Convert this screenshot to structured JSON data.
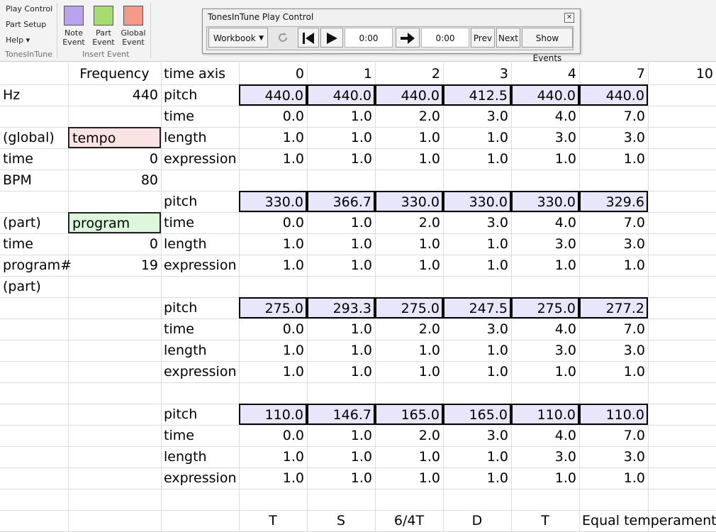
{
  "ribbon": {
    "links": [
      "Play Control",
      "Part Setup",
      "Help ▾"
    ],
    "group1_label": "TonesInTune",
    "events": [
      {
        "label1": "Note",
        "label2": "Event",
        "color": "#b9a3ee"
      },
      {
        "label1": "Part",
        "label2": "Event",
        "color": "#a8dc72"
      },
      {
        "label1": "Global",
        "label2": "Event",
        "color": "#f49a8a"
      }
    ],
    "group2_label": "Insert Event"
  },
  "play_control": {
    "title": "TonesInTune Play Control",
    "close": "✕",
    "workbook": "Workbook",
    "time_start": "0:00",
    "time_end": "0:00",
    "prev": "Prev",
    "next": "Next",
    "show_events": "Show Events"
  },
  "sheet": {
    "left": {
      "frequency": "Frequency",
      "hz_label": "Hz",
      "hz_value": "440",
      "global": "(global)",
      "tempo": "tempo",
      "time1_label": "time",
      "time1_value": "0",
      "bpm_label": "BPM",
      "bpm_value": "80",
      "part1": "(part)",
      "program": "program",
      "time2_label": "time",
      "time2_value": "0",
      "program_num_label": "program#",
      "program_num_value": "19",
      "part2": "(part)"
    },
    "time_axis": {
      "label": "time axis",
      "values": [
        "0",
        "1",
        "2",
        "3",
        "4",
        "7",
        "10"
      ]
    },
    "row_labels": [
      "pitch",
      "time",
      "length",
      "expression"
    ],
    "parts": [
      {
        "pitch": [
          "440.0",
          "440.0",
          "440.0",
          "412.5",
          "440.0",
          "440.0"
        ],
        "time": [
          "0.0",
          "1.0",
          "2.0",
          "3.0",
          "4.0",
          "7.0"
        ],
        "length": [
          "1.0",
          "1.0",
          "1.0",
          "1.0",
          "3.0",
          "3.0"
        ],
        "expression": [
          "1.0",
          "1.0",
          "1.0",
          "1.0",
          "1.0",
          "1.0"
        ]
      },
      {
        "pitch": [
          "330.0",
          "366.7",
          "330.0",
          "330.0",
          "330.0",
          "329.6"
        ],
        "time": [
          "0.0",
          "1.0",
          "2.0",
          "3.0",
          "4.0",
          "7.0"
        ],
        "length": [
          "1.0",
          "1.0",
          "1.0",
          "1.0",
          "3.0",
          "3.0"
        ],
        "expression": [
          "1.0",
          "1.0",
          "1.0",
          "1.0",
          "1.0",
          "1.0"
        ]
      },
      {
        "pitch": [
          "275.0",
          "293.3",
          "275.0",
          "247.5",
          "275.0",
          "277.2"
        ],
        "time": [
          "0.0",
          "1.0",
          "2.0",
          "3.0",
          "4.0",
          "7.0"
        ],
        "length": [
          "1.0",
          "1.0",
          "1.0",
          "1.0",
          "3.0",
          "3.0"
        ],
        "expression": [
          "1.0",
          "1.0",
          "1.0",
          "1.0",
          "1.0",
          "1.0"
        ]
      },
      {
        "pitch": [
          "110.0",
          "146.7",
          "165.0",
          "165.0",
          "110.0",
          "110.0"
        ],
        "time": [
          "0.0",
          "1.0",
          "2.0",
          "3.0",
          "4.0",
          "7.0"
        ],
        "length": [
          "1.0",
          "1.0",
          "1.0",
          "1.0",
          "3.0",
          "3.0"
        ],
        "expression": [
          "1.0",
          "1.0",
          "1.0",
          "1.0",
          "1.0",
          "1.0"
        ]
      }
    ],
    "footer": [
      "T",
      "S",
      "6/4T",
      "D",
      "T",
      "Equal temperament"
    ],
    "colors": {
      "pitch_fill": "#e7e6fb",
      "tempo_fill": "#fbe3e3",
      "program_fill": "#dcf7dc"
    }
  }
}
